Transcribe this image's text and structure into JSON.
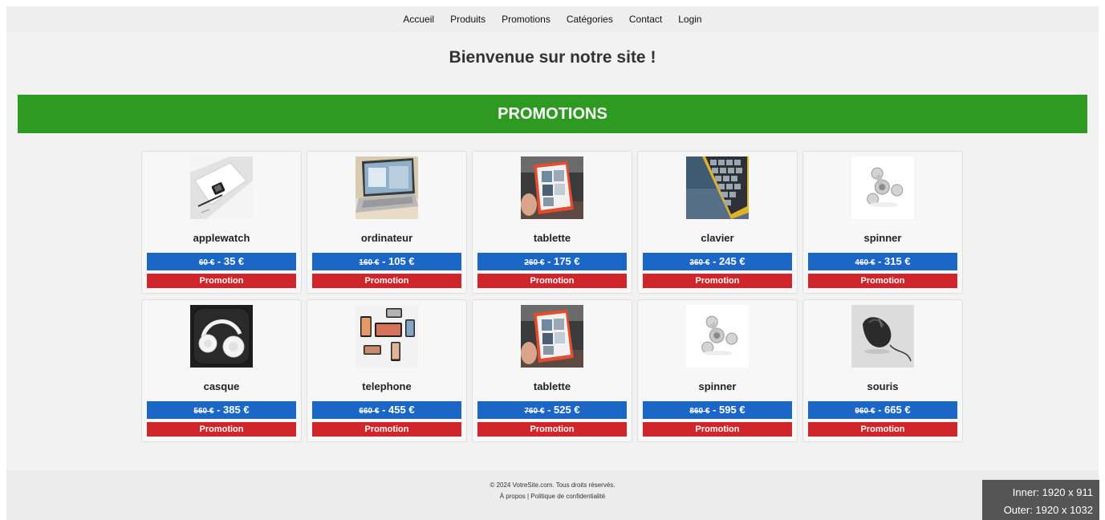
{
  "nav": {
    "items": [
      "Accueil",
      "Produits",
      "Promotions",
      "Catégories",
      "Contact",
      "Login"
    ]
  },
  "welcome": "Bienvenue sur notre site !",
  "banner": "PROMOTIONS",
  "products": [
    {
      "name": "applewatch",
      "old_price": "60 €",
      "new_price": "35 €",
      "badge": "Promotion",
      "image": "applewatch"
    },
    {
      "name": "ordinateur",
      "old_price": "160 €",
      "new_price": "105 €",
      "badge": "Promotion",
      "image": "laptop"
    },
    {
      "name": "tablette",
      "old_price": "260 €",
      "new_price": "175 €",
      "badge": "Promotion",
      "image": "tablet"
    },
    {
      "name": "clavier",
      "old_price": "360 €",
      "new_price": "245 €",
      "badge": "Promotion",
      "image": "keyboard"
    },
    {
      "name": "spinner",
      "old_price": "460 €",
      "new_price": "315 €",
      "badge": "Promotion",
      "image": "spinner"
    },
    {
      "name": "casque",
      "old_price": "560 €",
      "new_price": "385 €",
      "badge": "Promotion",
      "image": "headphones"
    },
    {
      "name": "telephone",
      "old_price": "660 €",
      "new_price": "455 €",
      "badge": "Promotion",
      "image": "phones"
    },
    {
      "name": "tablette",
      "old_price": "760 €",
      "new_price": "525 €",
      "badge": "Promotion",
      "image": "tablet"
    },
    {
      "name": "spinner",
      "old_price": "860 €",
      "new_price": "595 €",
      "badge": "Promotion",
      "image": "spinner"
    },
    {
      "name": "souris",
      "old_price": "960 €",
      "new_price": "665 €",
      "badge": "Promotion",
      "image": "mouse"
    }
  ],
  "footer": {
    "copyright": "© 2024 VotreSite.com. Tous droits réservés.",
    "link_about": "À propos",
    "separator": " | ",
    "link_privacy": "Politique de confidentialité"
  },
  "overlay": {
    "inner": "Inner: 1920 x 911",
    "outer": "Outer: 1920 x 1032"
  },
  "colors": {
    "banner": "#2e9a21",
    "price": "#1c66c6",
    "promo": "#d0262b"
  }
}
